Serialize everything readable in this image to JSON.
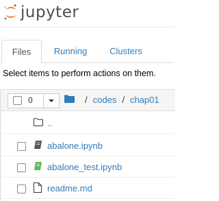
{
  "app": {
    "logo_text": "jupyter",
    "logo_icon": "jupyter-logo-icon",
    "brand_color": "#f37626"
  },
  "tabs": [
    {
      "label": "Files",
      "active": true
    },
    {
      "label": "Running",
      "active": false
    },
    {
      "label": "Clusters",
      "active": false
    }
  ],
  "instructions": "Select items to perform actions on them.",
  "toolbar": {
    "selected_count": "0",
    "dropdown_icon": "caret-down-icon"
  },
  "breadcrumb": {
    "root_icon": "folder-icon",
    "separator": "/",
    "parts": [
      "codes",
      "chap01"
    ]
  },
  "files": [
    {
      "name": "..",
      "type": "parent",
      "icon": "folder-outline-icon"
    },
    {
      "name": "abalone.ipynb",
      "type": "notebook",
      "icon": "notebook-icon",
      "running": false
    },
    {
      "name": "abalone_test.ipynb",
      "type": "notebook",
      "icon": "notebook-icon",
      "running": true
    },
    {
      "name": "readme.md",
      "type": "file",
      "icon": "file-icon"
    }
  ],
  "colors": {
    "link": "#337ab7",
    "notebook_idle": "#555555",
    "notebook_running": "#5cb85c"
  }
}
